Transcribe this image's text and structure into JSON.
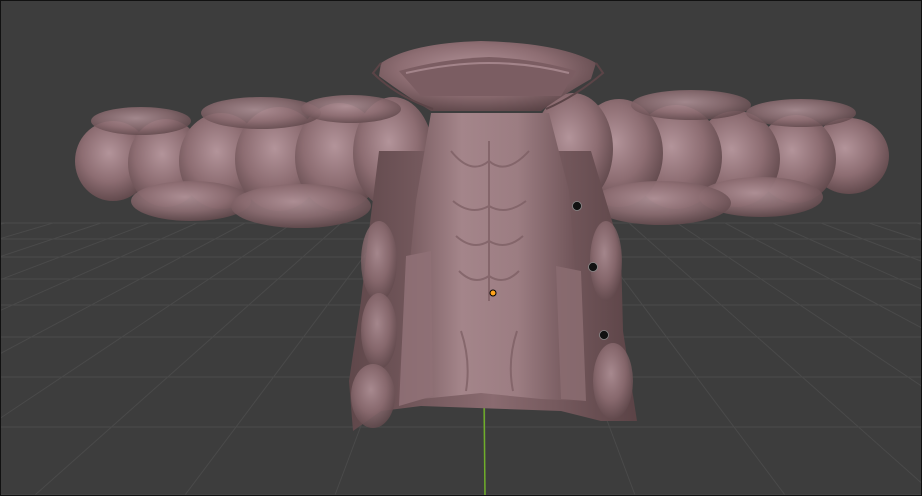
{
  "viewport": {
    "background": "#3d3d3d",
    "grid_color": "#4a4a4a",
    "y_axis_color": "#6fae2a",
    "origin_color": "#ffa41c"
  },
  "object": {
    "name": "",
    "material_color": "#8c6c70",
    "shadow_color": "#4a3538",
    "highlight_color": "#b4959a"
  },
  "buttons": [
    {
      "name": "button-upper"
    },
    {
      "name": "button-middle"
    },
    {
      "name": "button-lower"
    }
  ]
}
